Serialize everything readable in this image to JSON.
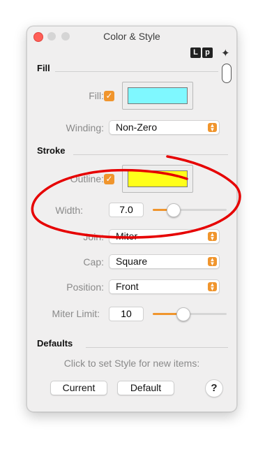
{
  "window": {
    "title": "Color & Style"
  },
  "logo": {
    "l": "L",
    "p": "p",
    "sparkle": "✦"
  },
  "fill": {
    "section_label": "Fill",
    "fill_label": "Fill:",
    "fill_checked": true,
    "fill_color": "#7ff8ff",
    "winding_label": "Winding:",
    "winding_value": "Non-Zero"
  },
  "stroke": {
    "section_label": "Stroke",
    "outline_label": "Outline:",
    "outline_checked": true,
    "outline_color": "#ffff1a",
    "width_label": "Width:",
    "width_value": "7.0",
    "width_slider_level": 0.27,
    "join_label": "Join:",
    "join_value": "Miter",
    "cap_label": "Cap:",
    "cap_value": "Square",
    "position_label": "Position:",
    "position_value": "Front",
    "miter_label": "Miter Limit:",
    "miter_value": "10",
    "miter_slider_level": 0.41
  },
  "defaults": {
    "section_label": "Defaults",
    "hint": "Click to set Style for new items:",
    "current_label": "Current",
    "default_label": "Default",
    "help_label": "?"
  },
  "colors": {
    "accent": "#f0952d",
    "annotation": "#e60000"
  }
}
